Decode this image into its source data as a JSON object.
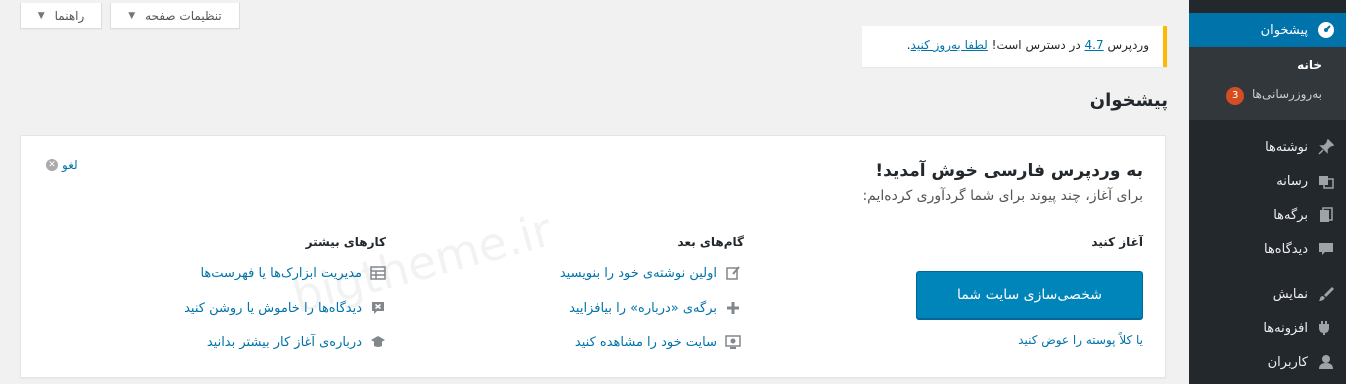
{
  "header_buttons": {
    "screen_options": "تنظیمات صفحه",
    "help": "راهنما"
  },
  "notice": {
    "prefix": "وردپرس",
    "version_link": "4.7",
    "middle": "در دسترس است!",
    "update_link": "لطفا به‌روز کنید",
    "suffix": "."
  },
  "page_title": "پیشخوان",
  "watermark": "bigtheme.ir",
  "welcome": {
    "title": "به وردپرس فارسی خوش آمدید!",
    "subtitle": "برای آغاز، چند پیوند برای شما گردآوری کرده‌ایم:",
    "dismiss": "لغو",
    "col1_title": "آغاز کنید",
    "cta_button": "شخصی‌سازی سایت شما",
    "cta_alt": "یا کلاً پوسته را عوض کنید",
    "col2_title": "گام‌های بعد",
    "next_steps": [
      {
        "label": "اولین نوشته‌ی خود را بنویسید",
        "icon": "edit-icon"
      },
      {
        "label": "برگه‌ی «درباره» را بیافزایید",
        "icon": "plus-icon"
      },
      {
        "label": "سایت خود را مشاهده کنید",
        "icon": "view-site-icon"
      }
    ],
    "col3_title": "کارهای بیشتر",
    "more_actions": [
      {
        "label": "مدیریت ابزارک‌ها یا فهرست‌ها",
        "icon": "widgets-icon"
      },
      {
        "label": "دیدگاه‌ها را خاموش یا روشن کنید",
        "icon": "comments-toggle-icon"
      },
      {
        "label": "درباره‌ی آغاز کار بیشتر بدانید",
        "icon": "learn-more-icon"
      }
    ]
  },
  "sidebar": {
    "dashboard": "پیشخوان",
    "home": "خانه",
    "updates": "به‌روزرسانی‌ها",
    "updates_count": "3",
    "items": [
      {
        "label": "نوشته‌ها",
        "icon": "pin-icon"
      },
      {
        "label": "رسانه",
        "icon": "media-icon"
      },
      {
        "label": "برگه‌ها",
        "icon": "pages-icon"
      },
      {
        "label": "دیدگاه‌ها",
        "icon": "comments-icon"
      },
      {
        "label": "نمایش",
        "icon": "appearance-icon"
      },
      {
        "label": "افزونه‌ها",
        "icon": "plugins-icon"
      },
      {
        "label": "کاربران",
        "icon": "users-icon"
      }
    ]
  }
}
